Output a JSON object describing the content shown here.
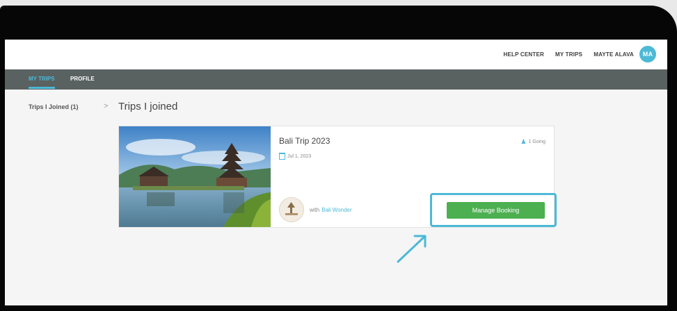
{
  "topnav": {
    "help_center": "HELP CENTER",
    "my_trips": "MY TRIPS",
    "user_name": "MAYTE ALAVA",
    "avatar_initials": "MA"
  },
  "subnav": {
    "my_trips": "MY TRIPS",
    "profile": "PROFILE"
  },
  "sidebar": {
    "trips_joined": "Trips I Joined (1)"
  },
  "page": {
    "chevron": ">",
    "title": "Trips I joined"
  },
  "trip": {
    "name": "Bali Trip 2023",
    "going": "1 Going",
    "date": "Jul 1, 2023",
    "with_label": "with",
    "operator": "Bali Wonder",
    "manage_button": "Manage Booking"
  },
  "colors": {
    "accent": "#4cb9d6",
    "subnav_bg": "#5a6161",
    "button": "#4caf50"
  }
}
